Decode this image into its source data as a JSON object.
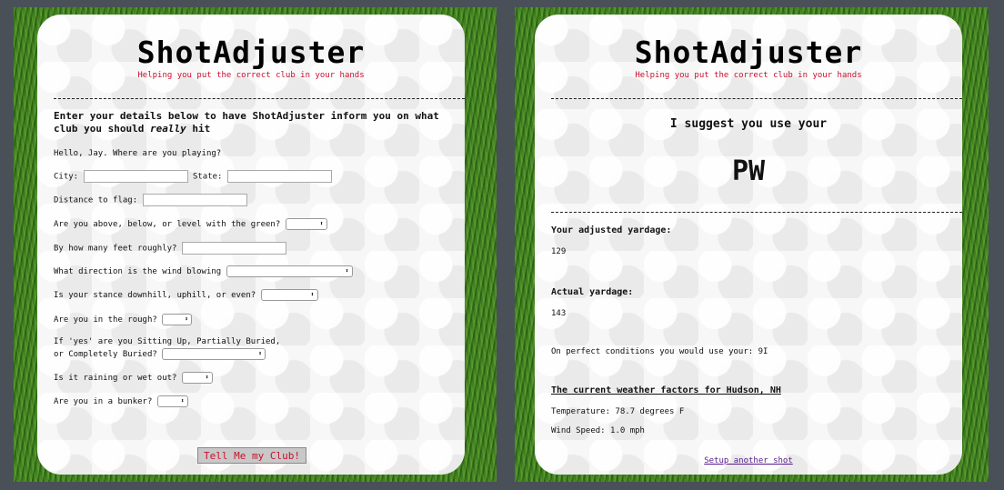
{
  "left_panel": {
    "brand": "ShotAdjuster",
    "tagline": "Helping you put the correct club in your hands",
    "intro_part1": "Enter your details below to have ShotAdjuster inform you on what club you should ",
    "intro_em": "really",
    "intro_part2": " hit",
    "greeting": "Hello, Jay. Where are you playing?",
    "city_label": "City:",
    "state_label": "State:",
    "distance_label": "Distance to flag:",
    "elevation_label": "Are you above, below, or level with the green?",
    "feet_label": "By how many feet roughly?",
    "wind_label": "What direction is the wind blowing",
    "stance_label": "Is your stance downhill, uphill, or even?",
    "rough_label": "Are you in the rough?",
    "lie_label_line1": "If 'yes' are you Sitting Up, Partially Buried,",
    "lie_label_line2": "or Completely Buried?",
    "rain_label": "Is it raining or wet out?",
    "bunker_label": "Are you in a bunker?",
    "submit_label": "Tell Me my Club!"
  },
  "right_panel": {
    "brand": "ShotAdjuster",
    "tagline": "Helping you put the correct club in your hands",
    "suggest_heading": "I suggest you use your",
    "club": "PW",
    "adjusted_label": "Your adjusted yardage:",
    "adjusted_value": "129",
    "actual_label": "Actual yardage:",
    "actual_value": "143",
    "perfect_text": "On perfect conditions you would use your: 9I",
    "weather_heading": "The current weather factors for Hudson, NH",
    "temperature": "Temperature: 78.7 degrees F",
    "wind_speed": "Wind Speed: 1.0 mph",
    "setup_link": "Setup another shot"
  },
  "colors": {
    "tagline": "#c8102e",
    "link": "#551a8b",
    "background": "#4a5058"
  }
}
